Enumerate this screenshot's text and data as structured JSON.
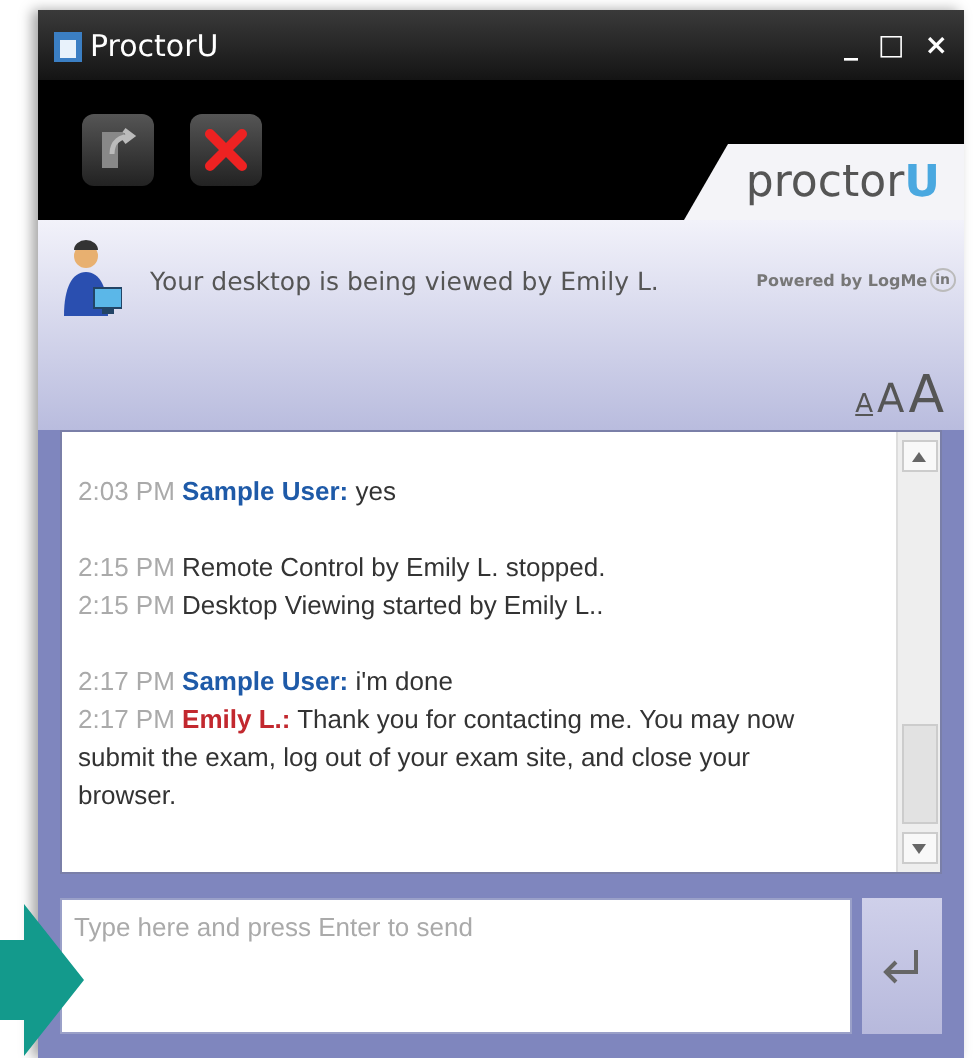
{
  "window": {
    "title": "ProctorU",
    "controls": [
      "_",
      "□",
      "×"
    ]
  },
  "toolbar": {
    "buttons": [
      {
        "kind": "exit"
      },
      {
        "kind": "stop"
      }
    ],
    "logo": {
      "text": "proctor",
      "mark": "U"
    }
  },
  "status": {
    "message": "Your desktop is being viewed by Emily L.",
    "powered_by": "Powered by LogMe",
    "powered_mark": "in"
  },
  "font_sizes": [
    {
      "label": "A",
      "selected": true
    },
    {
      "label": "A",
      "selected": false
    },
    {
      "label": "A",
      "selected": false
    }
  ],
  "chat": {
    "groups": [
      [
        {
          "kind": "user",
          "time": "2:03 PM",
          "sender": "Sample User:",
          "text": "yes"
        }
      ],
      [
        {
          "kind": "system",
          "time": "2:15 PM",
          "text": "Remote Control by Emily L. stopped."
        },
        {
          "kind": "system",
          "time": "2:15 PM",
          "text": "Desktop Viewing started by Emily L.."
        }
      ],
      [
        {
          "kind": "user",
          "time": "2:17 PM",
          "sender": "Sample User:",
          "text": "i'm done"
        },
        {
          "kind": "agent",
          "time": "2:17 PM",
          "sender": "Emily L.:",
          "text": "Thank you for contacting me. You may now submit the exam, log out of your exam site, and close your browser."
        }
      ]
    ]
  },
  "input": {
    "placeholder": "Type here and press Enter to send"
  }
}
